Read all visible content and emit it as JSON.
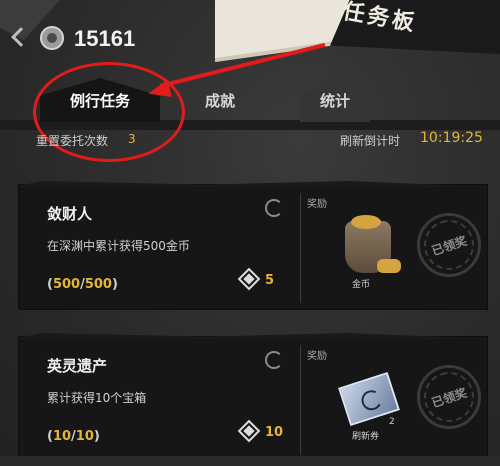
{
  "header": {
    "currency_value": "15161",
    "banner_title": "任务板"
  },
  "tabs": [
    {
      "label": "例行任务",
      "active": true
    },
    {
      "label": "成就",
      "active": false
    },
    {
      "label": "统计",
      "active": false
    }
  ],
  "info": {
    "delegation_label": "重置委托次数",
    "delegation_count": "3",
    "refresh_label": "刷新倒计时",
    "refresh_time": "10:19:25"
  },
  "tasks": [
    {
      "title": "敛财人",
      "description": "在深渊中累计获得500金币",
      "progress_current": "500",
      "progress_total": "500",
      "token_count": "5",
      "reward_label": "奖励",
      "reward_name": "金币",
      "reward_qty": "",
      "stamp": "已领奖"
    },
    {
      "title": "英灵遗产",
      "description": "累计获得10个宝箱",
      "progress_current": "10",
      "progress_total": "10",
      "token_count": "10",
      "reward_label": "奖励",
      "reward_name": "刷新券",
      "reward_qty": "2",
      "stamp": "已领奖"
    }
  ],
  "colors": {
    "accent_gold": "#e5b53a",
    "annotation_red": "#e21b1b"
  }
}
